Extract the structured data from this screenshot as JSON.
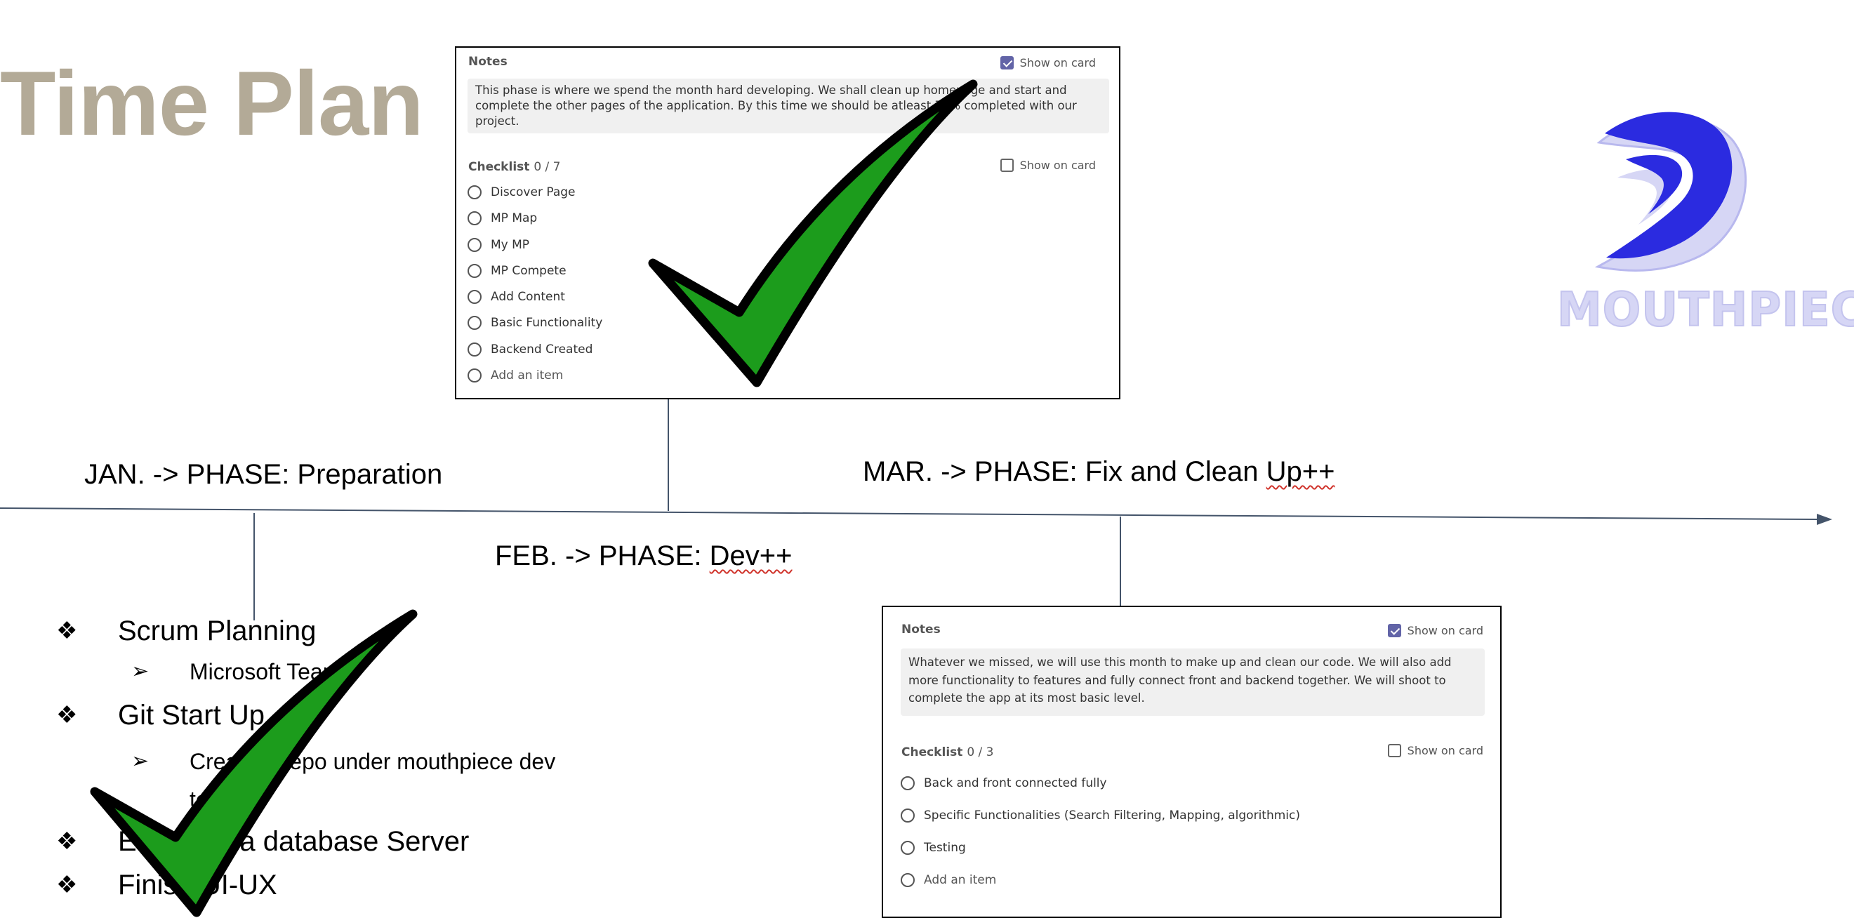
{
  "title": "Time Plan",
  "phases": {
    "jan": "JAN. -> PHASE: Preparation",
    "feb_prefix": "FEB. -> PHASE: ",
    "feb_word": "Dev++",
    "mar_prefix": "MAR. -> PHASE: Fix and Clean ",
    "mar_word": "Up++"
  },
  "card_feb": {
    "notes_label": "Notes",
    "show_on_card": "Show on card",
    "notes_text": "This phase is where we spend the month hard developing. We shall clean up homepage and start and complete the other pages of the application. By this time we should be atleast 70% completed with our project.",
    "checklist_label": "Checklist",
    "checklist_count": "0 / 7",
    "items": [
      "Discover Page",
      "MP Map",
      "My MP",
      "MP Compete",
      "Add Content",
      "Basic Functionality",
      "Backend Created"
    ],
    "add_item": "Add an item"
  },
  "card_mar": {
    "notes_label": "Notes",
    "show_on_card": "Show on card",
    "notes_text": "Whatever we missed, we will use this month to make up and clean our code. We will also add more functionality to features and fully connect front and backend together. We will shoot to complete the app at its most basic level.",
    "checklist_label": "Checklist",
    "checklist_count": "0 / 3",
    "items": [
      "Back and front connected fully",
      "Specific Functionalities (Search Filtering, Mapping, algorithmic)",
      "Testing"
    ],
    "add_item": "Add an item"
  },
  "bullets": [
    {
      "text": "Scrum Planning",
      "sub": [
        "Microsoft Teams"
      ]
    },
    {
      "text": "Git Start Up",
      "sub": [
        "Create a repo under mouthpiece dev team"
      ]
    },
    {
      "text": "Establish a database Server",
      "sub": []
    },
    {
      "text": "Finish UI-UX",
      "sub": []
    }
  ],
  "bullet_symbols": {
    "level1": "❖",
    "level2": "➢"
  },
  "logo": {
    "text": "MOUTHPIECE",
    "color": "#2b2be0",
    "light_color": "#d6d6f5"
  },
  "checkmark_color": "#1c9c1c",
  "title_color": "#b3aa97"
}
